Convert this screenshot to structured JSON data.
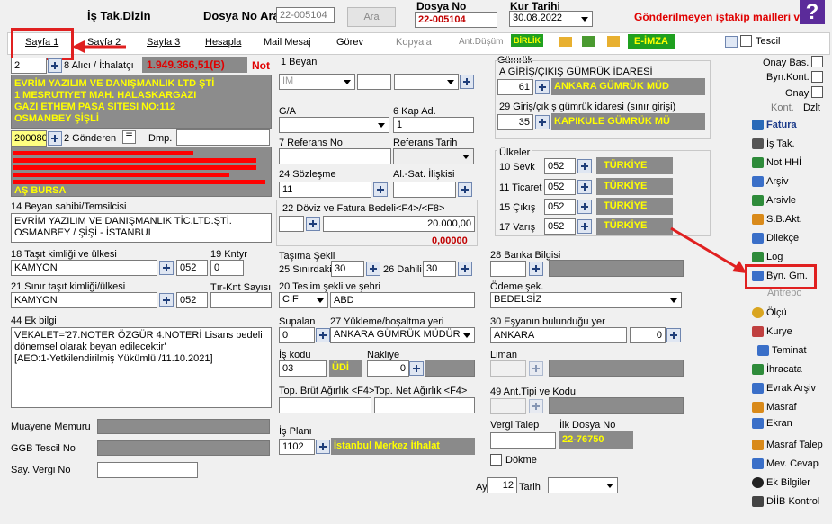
{
  "header": {
    "title": "İş Tak.Dizin",
    "dosya_no_ara_label": "Dosya No Ara",
    "dosya_no_ara_value": "22-005104",
    "ara_button": "Ara",
    "dosya_no_label": "Dosya No",
    "dosya_no_value": "22-005104",
    "kur_tarihi_label": "Kur Tarihi",
    "kur_tarihi_value": "30.08.2022",
    "warning": "Gönderilmeyen iştakip mailleri var"
  },
  "tabs": [
    {
      "label": "Sayfa 1"
    },
    {
      "label": "Sayfa 2"
    },
    {
      "label": "Sayfa 3"
    },
    {
      "label": "Hesapla"
    },
    {
      "label": "Mail Mesaj"
    },
    {
      "label": "Görev"
    },
    {
      "label": "Kopyala"
    },
    {
      "label": "Ant.Düşüm"
    }
  ],
  "toolbar": {
    "birlik": "BİRLİK",
    "eimza": "E-İMZA",
    "tescil": "Tescil"
  },
  "left": {
    "alici_no": "2",
    "alici_label": "8 Alıcı / İthalatçı",
    "alici_amount": "1.949.366,51(B)",
    "not_label": "Not",
    "alici_lines": [
      "EVRİM YAZILIM VE DANIŞMANLIK LTD ŞTİ",
      "1 MESRUTIYET MAH. HALASKARGAZI",
      "GAZI ETHEM PASA SITESI NO:112",
      "OSMANBEY ŞİŞLİ"
    ],
    "gonderen_no": "200080",
    "gonderen_label": "2 Gönderen",
    "dmp_label": "Dmp.",
    "gonderen_last_line": "AŞ BURSA",
    "beyan_sahibi_label": "14 Beyan sahibi/Temsilcisi",
    "beyan_sahibi_lines": [
      "EVRİM YAZILIM VE DANIŞMANLIK TİC.LTD.ŞTİ.",
      "OSMANBEY / ŞİŞİ - İSTANBUL"
    ],
    "tasit_label": "18 Taşıt kimliği ve ülkesi",
    "tasit_value": "KAMYON",
    "tasit_ulke": "052",
    "kntyr_label": "19 Kntyr",
    "kntyr_value": "0",
    "sinir_tasit_label": "21 Sınır taşıt kimliği/ülkesi",
    "sinir_tasit_value": "KAMYON",
    "sinir_tasit_ulke": "052",
    "tir_label": "Tır-Knt Sayısı",
    "ek_bilgi_label": "44 Ek bilgi",
    "ek_bilgi_lines": [
      "VEKALET='27.NOTER ÖZGÜR 4.NOTERİ Lisans bedeli",
      "dönemsel olarak beyan edilecektir'",
      "[AEO:1-Yetkilendirilmiş Yükümlü /11.10.2021]"
    ],
    "muayene_label": "Muayene Memuru",
    "ggb_label": "GGB Tescil No",
    "say_vergi_label": "Say. Vergi No"
  },
  "middle": {
    "beyan_label": "1 Beyan",
    "beyan_value": "IM",
    "ga_label": "G/A",
    "kap_label": "6 Kap Ad.",
    "kap_value": "1",
    "ref_label": "7 Referans No",
    "ref_tarih_label": "Referans Tarih",
    "sozlesme_label": "24 Sözleşme",
    "sozlesme_value": "11",
    "alsat_label": "Al.-Sat. İlişkisi",
    "doviz_label": "22 Döviz ve Fatura Bedeli<F4>/<F8>",
    "doviz_value": "20.000,00",
    "doviz_extra": "0,00000",
    "tasima_label": "Taşıma Şekli",
    "sinirdaki_label": "25 Sınırdaki",
    "sinirdaki_value": "30",
    "dahili_label": "26 Dahili",
    "dahili_value": "30",
    "teslim_label": "20 Teslim şekli ve şehri",
    "teslim_value": "CIF",
    "teslim_sehir": "ABD",
    "supalan_label": "Supalan",
    "supalan_value": "0",
    "yukleme_label": "27 Yükleme/boşaltma yeri",
    "yukleme_value": "ANKARA GÜMRÜK MÜDÜR",
    "is_kodu_label": "İş kodu",
    "is_kodu_value": "03",
    "udi": "ÜDİ",
    "nakliye_label": "Nakliye",
    "nakliye_value": "0",
    "brut_label": "Top. Brüt Ağırlık <F4>",
    "net_label": "Top. Net Ağırlık <F4>",
    "is_plani_label": "İş Planı",
    "is_plani_value": "1102",
    "is_plani_name": "İstanbul Merkez İthalat"
  },
  "right": {
    "gumruk_label": "Gümrük",
    "giris_label": "A GİRİŞ/ÇIKIŞ GÜMRÜK İDARESİ",
    "giris_no": "61",
    "giris_name": "ANKARA GÜMRÜK MÜD",
    "giris29_label": "29 Giriş/çıkış gümrük idaresi (sınır girişi)",
    "giris29_no": "35",
    "giris29_name": "KAPIKULE GÜMRÜK MÜ",
    "ulkeler_label": "Ülkeler",
    "ulkeler": [
      {
        "label": "10 Sevk",
        "code": "052",
        "name": "TÜRKİYE"
      },
      {
        "label": "11 Ticaret",
        "code": "052",
        "name": "TÜRKİYE"
      },
      {
        "label": "15 Çıkış",
        "code": "052",
        "name": "TÜRKİYE"
      },
      {
        "label": "17 Varış",
        "code": "052",
        "name": "TÜRKİYE"
      }
    ],
    "banka_label": "28 Banka Bilgisi",
    "odeme_label": "Ödeme şek.",
    "odeme_value": "BEDELSİZ",
    "esya_label": "30 Eşyanın bulunduğu yer",
    "esya_value": "ANKARA",
    "esya_no": "0",
    "liman_label": "Liman",
    "ant_label": "49 Ant.Tipi ve Kodu",
    "vergi_talep_label": "Vergi Talep",
    "ilk_dosya_label": "İlk Dosya No",
    "ilk_dosya_value": "22-76750",
    "dokme_label": "Dökme",
    "ay_label": "Ay",
    "ay_value": "12",
    "tarih_label": "Tarih"
  },
  "sidebar": {
    "onay_bas": "Onay Bas.",
    "byn_kont": "Byn.Kont.",
    "onay": "Onay",
    "kont": "Kont.",
    "dzlt": "Dzlt",
    "buttons": [
      {
        "label": "Fatura",
        "icon": "invoice-icon",
        "color": "#2a6ab8"
      },
      {
        "label": "İş Tak.",
        "icon": "tracking-icon",
        "color": "#555555"
      },
      {
        "label": "Not HHİ",
        "icon": "note-icon",
        "color": "#2e8b3a"
      },
      {
        "label": "Arşiv",
        "icon": "archive-icon",
        "color": "#3a6fc8"
      },
      {
        "label": "Arsivle",
        "icon": "archive-add-icon",
        "color": "#2e8b3a"
      },
      {
        "label": "S.B.Akt.",
        "icon": "transfer-icon",
        "color": "#d98a1a"
      },
      {
        "label": "Dilekçe",
        "icon": "petition-icon",
        "color": "#3a6fc8"
      },
      {
        "label": "Log",
        "icon": "log-icon",
        "color": "#2e8b3a"
      },
      {
        "label": "Byn. Gm.",
        "icon": "declaration-icon",
        "color": "#3a6fc8"
      },
      {
        "label": "Antrepo",
        "icon": "",
        "color": ""
      },
      {
        "label": "Ölçü",
        "icon": "measure-icon",
        "color": "#d9a520"
      },
      {
        "label": "Kurye",
        "icon": "courier-icon",
        "color": "#c04040"
      },
      {
        "label": "Teminat",
        "icon": "guarantee-icon",
        "color": "#3a6fc8"
      },
      {
        "label": "İhracata",
        "icon": "export-icon",
        "color": "#2e8b3a"
      },
      {
        "label": "Evrak Arşiv",
        "icon": "doc-archive-icon",
        "color": "#3a6fc8"
      },
      {
        "label": "Masraf",
        "icon": "expense-icon",
        "color": "#d98a1a"
      },
      {
        "label": "Ekran",
        "icon": "screen-icon",
        "color": "#3a6fc8"
      },
      {
        "label": "Masraf Talep",
        "icon": "expense-request-icon",
        "color": "#d98a1a"
      },
      {
        "label": "Mev. Cevap",
        "icon": "reply-icon",
        "color": "#3a6fc8"
      },
      {
        "label": "Ek Bilgiler",
        "icon": "info-icon",
        "color": "#222222"
      },
      {
        "label": "DİİB Kontrol",
        "icon": "check-icon",
        "color": "#444444"
      }
    ]
  }
}
